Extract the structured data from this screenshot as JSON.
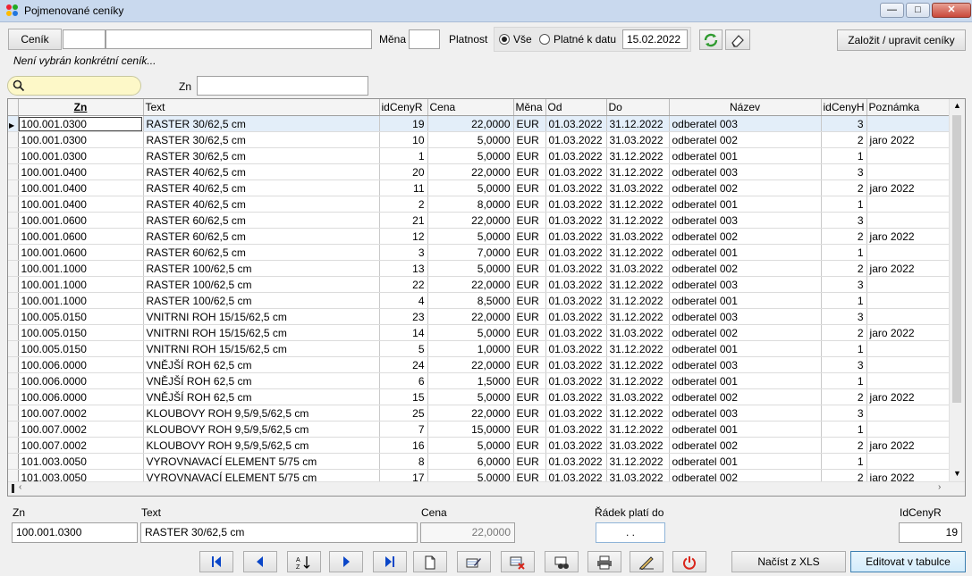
{
  "window": {
    "title": "Pojmenované ceníky"
  },
  "toolbar": {
    "cenik_button": "Ceník",
    "cenik_code": "",
    "cenik_name": "",
    "mena_label": "Měna",
    "mena_value": "",
    "platnost_label": "Platnost",
    "radio_all": "Vše",
    "radio_date": "Platné k datu",
    "date_value": "15.02.2022",
    "create_button": "Založit / upravit ceníky"
  },
  "status": "Není vybrán konkrétní ceník...",
  "filter": {
    "search_value": "",
    "zn_label": "Zn",
    "zn_value": ""
  },
  "columns": [
    "Zn",
    "Text",
    "idCenyR",
    "Cena",
    "Měna",
    "Od",
    "Do",
    "Název",
    "idCenyH",
    "Poznámka"
  ],
  "rows": [
    [
      "100.001.0300",
      "RASTER  30/62,5 cm",
      "19",
      "22,0000",
      "EUR",
      "01.03.2022",
      "31.12.2022",
      "odberatel 003",
      "3",
      ""
    ],
    [
      "100.001.0300",
      "RASTER  30/62,5 cm",
      "10",
      "5,0000",
      "EUR",
      "01.03.2022",
      "31.03.2022",
      "odberatel 002",
      "2",
      "jaro 2022"
    ],
    [
      "100.001.0300",
      "RASTER  30/62,5 cm",
      "1",
      "5,0000",
      "EUR",
      "01.03.2022",
      "31.12.2022",
      "odberatel 001",
      "1",
      ""
    ],
    [
      "100.001.0400",
      "RASTER  40/62,5 cm",
      "20",
      "22,0000",
      "EUR",
      "01.03.2022",
      "31.12.2022",
      "odberatel 003",
      "3",
      ""
    ],
    [
      "100.001.0400",
      "RASTER  40/62,5 cm",
      "11",
      "5,0000",
      "EUR",
      "01.03.2022",
      "31.03.2022",
      "odberatel 002",
      "2",
      "jaro 2022"
    ],
    [
      "100.001.0400",
      "RASTER  40/62,5 cm",
      "2",
      "8,0000",
      "EUR",
      "01.03.2022",
      "31.12.2022",
      "odberatel 001",
      "1",
      ""
    ],
    [
      "100.001.0600",
      "RASTER  60/62,5 cm",
      "21",
      "22,0000",
      "EUR",
      "01.03.2022",
      "31.12.2022",
      "odberatel 003",
      "3",
      ""
    ],
    [
      "100.001.0600",
      "RASTER  60/62,5 cm",
      "12",
      "5,0000",
      "EUR",
      "01.03.2022",
      "31.03.2022",
      "odberatel 002",
      "2",
      "jaro 2022"
    ],
    [
      "100.001.0600",
      "RASTER  60/62,5 cm",
      "3",
      "7,0000",
      "EUR",
      "01.03.2022",
      "31.12.2022",
      "odberatel 001",
      "1",
      ""
    ],
    [
      "100.001.1000",
      "RASTER 100/62,5 cm",
      "13",
      "5,0000",
      "EUR",
      "01.03.2022",
      "31.03.2022",
      "odberatel 002",
      "2",
      "jaro 2022"
    ],
    [
      "100.001.1000",
      "RASTER 100/62,5 cm",
      "22",
      "22,0000",
      "EUR",
      "01.03.2022",
      "31.12.2022",
      "odberatel 003",
      "3",
      ""
    ],
    [
      "100.001.1000",
      "RASTER 100/62,5 cm",
      "4",
      "8,5000",
      "EUR",
      "01.03.2022",
      "31.12.2022",
      "odberatel 001",
      "1",
      ""
    ],
    [
      "100.005.0150",
      "VNITRNI ROH 15/15/62,5 cm",
      "23",
      "22,0000",
      "EUR",
      "01.03.2022",
      "31.12.2022",
      "odberatel 003",
      "3",
      ""
    ],
    [
      "100.005.0150",
      "VNITRNI ROH 15/15/62,5 cm",
      "14",
      "5,0000",
      "EUR",
      "01.03.2022",
      "31.03.2022",
      "odberatel 002",
      "2",
      "jaro 2022"
    ],
    [
      "100.005.0150",
      "VNITRNI ROH 15/15/62,5 cm",
      "5",
      "1,0000",
      "EUR",
      "01.03.2022",
      "31.12.2022",
      "odberatel 001",
      "1",
      ""
    ],
    [
      "100.006.0000",
      "VNĚJŠÍ ROH 62,5 cm",
      "24",
      "22,0000",
      "EUR",
      "01.03.2022",
      "31.12.2022",
      "odberatel 003",
      "3",
      ""
    ],
    [
      "100.006.0000",
      "VNĚJŠÍ ROH 62,5 cm",
      "6",
      "1,5000",
      "EUR",
      "01.03.2022",
      "31.12.2022",
      "odberatel 001",
      "1",
      ""
    ],
    [
      "100.006.0000",
      "VNĚJŠÍ ROH 62,5 cm",
      "15",
      "5,0000",
      "EUR",
      "01.03.2022",
      "31.03.2022",
      "odberatel 002",
      "2",
      "jaro 2022"
    ],
    [
      "100.007.0002",
      "KLOUBOVY ROH 9,5/9,5/62,5 cm",
      "25",
      "22,0000",
      "EUR",
      "01.03.2022",
      "31.12.2022",
      "odberatel 003",
      "3",
      ""
    ],
    [
      "100.007.0002",
      "KLOUBOVY ROH 9,5/9,5/62,5 cm",
      "7",
      "15,0000",
      "EUR",
      "01.03.2022",
      "31.12.2022",
      "odberatel 001",
      "1",
      ""
    ],
    [
      "100.007.0002",
      "KLOUBOVY ROH 9,5/9,5/62,5 cm",
      "16",
      "5,0000",
      "EUR",
      "01.03.2022",
      "31.03.2022",
      "odberatel 002",
      "2",
      "jaro 2022"
    ],
    [
      "101.003.0050",
      "VYROVNAVACÍ ELEMENT  5/75 cm",
      "8",
      "6,0000",
      "EUR",
      "01.03.2022",
      "31.12.2022",
      "odberatel 001",
      "1",
      ""
    ],
    [
      "101.003.0050",
      "VYROVNAVACÍ ELEMENT  5/75 cm",
      "17",
      "5,0000",
      "EUR",
      "01.03.2022",
      "31.03.2022",
      "odberatel 002",
      "2",
      "jaro 2022"
    ]
  ],
  "selected_row": 0,
  "detail": {
    "zn_label": "Zn",
    "zn_value": "100.001.0300",
    "text_label": "Text",
    "text_value": "RASTER  30/62,5 cm",
    "cena_label": "Cena",
    "cena_value": "22,0000",
    "radek_label": "Řádek platí do",
    "radek_value": ". .",
    "idcenyr_label": "IdCenyR",
    "idcenyr_value": "19"
  },
  "buttons": {
    "import_xls": "Načíst z XLS",
    "edit_table": "Editovat v tabulce"
  },
  "colors": {
    "accent": "#0a6ad6",
    "search_bg": "#fdf8c8",
    "selected_row": "#e3eef9",
    "power_red": "#d9261c"
  }
}
